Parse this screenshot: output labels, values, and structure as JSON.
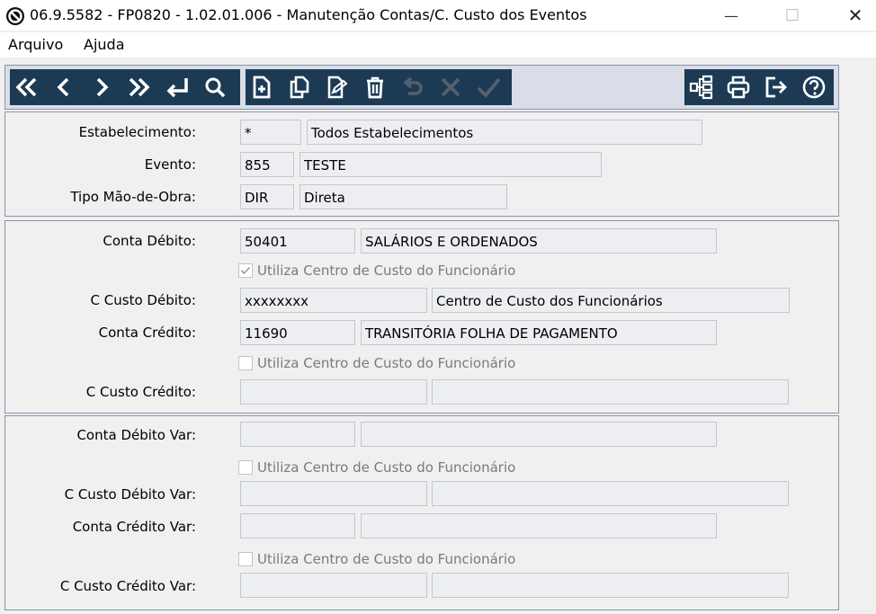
{
  "window": {
    "title": "06.9.5582 - FP0820 - 1.02.01.006 - Manutenção Contas/C. Custo dos Eventos",
    "minimize": "—",
    "maximize": "☐",
    "close": "✕"
  },
  "menu": {
    "file": "Arquivo",
    "help": "Ajuda"
  },
  "header": {
    "estabelecimento_label": "Estabelecimento:",
    "estabelecimento_code": "*",
    "estabelecimento_desc": "Todos Estabelecimentos",
    "evento_label": "Evento:",
    "evento_code": "855",
    "evento_desc": "TESTE",
    "tipo_label": "Tipo Mão-de-Obra:",
    "tipo_code": "DIR",
    "tipo_desc": "Direta"
  },
  "accounts": {
    "conta_debito_label": "Conta Débito:",
    "conta_debito_code": "50401",
    "conta_debito_desc": "SALÁRIOS E ORDENADOS",
    "chk1_label": "Utiliza Centro de Custo do Funcionário",
    "chk1_checked": true,
    "ccusto_debito_label": "C Custo Débito:",
    "ccusto_debito_code": "xxxxxxxx",
    "ccusto_debito_desc": "Centro de Custo dos Funcionários",
    "conta_credito_label": "Conta Crédito:",
    "conta_credito_code": "11690",
    "conta_credito_desc": "TRANSITÓRIA FOLHA DE PAGAMENTO",
    "chk2_label": "Utiliza Centro de Custo do Funcionário",
    "chk2_checked": false,
    "ccusto_credito_label": "C Custo Crédito:",
    "ccusto_credito_code": "",
    "ccusto_credito_desc": ""
  },
  "variable": {
    "conta_debito_var_label": "Conta Débito Var:",
    "conta_debito_var_code": "",
    "conta_debito_var_desc": "",
    "chk3_label": "Utiliza Centro de Custo do Funcionário",
    "chk3_checked": false,
    "ccusto_debito_var_label": "C Custo Débito Var:",
    "ccusto_debito_var_code": "",
    "ccusto_debito_var_desc": "",
    "conta_credito_var_label": "Conta Crédito Var:",
    "conta_credito_var_code": "",
    "conta_credito_var_desc": "",
    "chk4_label": "Utiliza Centro de Custo do Funcionário",
    "chk4_checked": false,
    "ccusto_credito_var_label": "C Custo Crédito Var:",
    "ccusto_credito_var_code": "",
    "ccusto_credito_var_desc": ""
  },
  "colors": {
    "toolbar_bg": "#1c3a53",
    "toolbar_frame": "#d8dde8",
    "field_bg": "#eceef1",
    "icon": "#ffffff"
  },
  "toolbar_icons": [
    "first-icon",
    "prev-icon",
    "next-icon",
    "last-icon",
    "goto-icon",
    "search-icon",
    "new-icon",
    "copy-icon",
    "edit-icon",
    "delete-icon",
    "undo-icon",
    "cancel-icon",
    "confirm-icon",
    "tree-icon",
    "print-icon",
    "exit-icon",
    "help-icon"
  ]
}
